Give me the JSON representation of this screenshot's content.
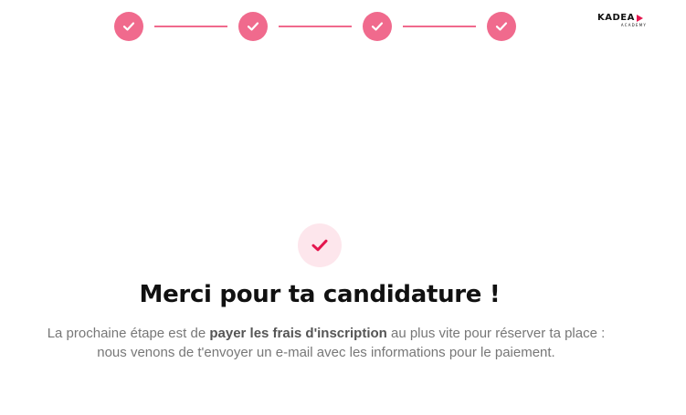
{
  "colors": {
    "accent": "#f06a8d",
    "brand_red": "#e4164e",
    "success_bg": "#fde6ec"
  },
  "stepper": {
    "steps": [
      {
        "icon": "check-icon",
        "state": "completed"
      },
      {
        "icon": "check-icon",
        "state": "completed"
      },
      {
        "icon": "check-icon",
        "state": "completed"
      },
      {
        "icon": "check-icon",
        "state": "completed"
      }
    ]
  },
  "logo": {
    "name": "KADEA",
    "sub": "ACADEMY"
  },
  "confirmation": {
    "icon": "check-icon",
    "title": "Merci pour ta candidature !",
    "line1_before": "La prochaine étape est de ",
    "line1_bold": "payer les frais d'inscription",
    "line1_after": " au plus vite pour réserver ta place :",
    "line2": "nous venons de t'envoyer un e-mail avec les informations pour le paiement."
  }
}
